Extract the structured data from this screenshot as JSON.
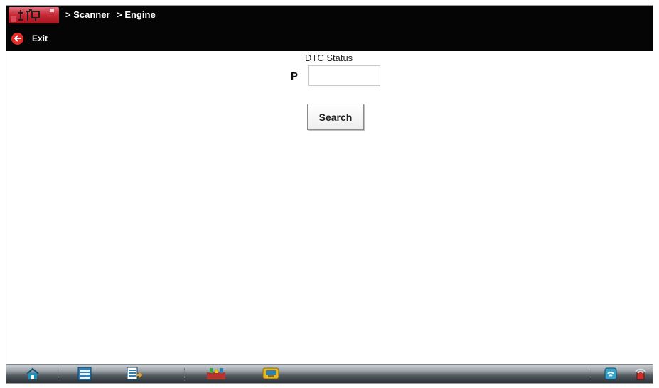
{
  "header": {
    "breadcrumb": [
      "> Scanner",
      "> Engine"
    ],
    "exit_label": "Exit"
  },
  "main": {
    "title": "DTC Status",
    "prefix": "P",
    "input": {
      "value": "",
      "placeholder": ""
    },
    "search_label": "Search"
  },
  "taskbar": {
    "items": [
      "home-icon",
      "scanner-icon",
      "data-list-icon",
      "tools-icon",
      "vehicle-icon"
    ],
    "right_items": [
      "connection-status-icon",
      "wireless-status-icon"
    ]
  },
  "colors": {
    "header_bg": "#050505",
    "exit_red": "#e62b2b",
    "app_icon_red": "#c92b39"
  }
}
